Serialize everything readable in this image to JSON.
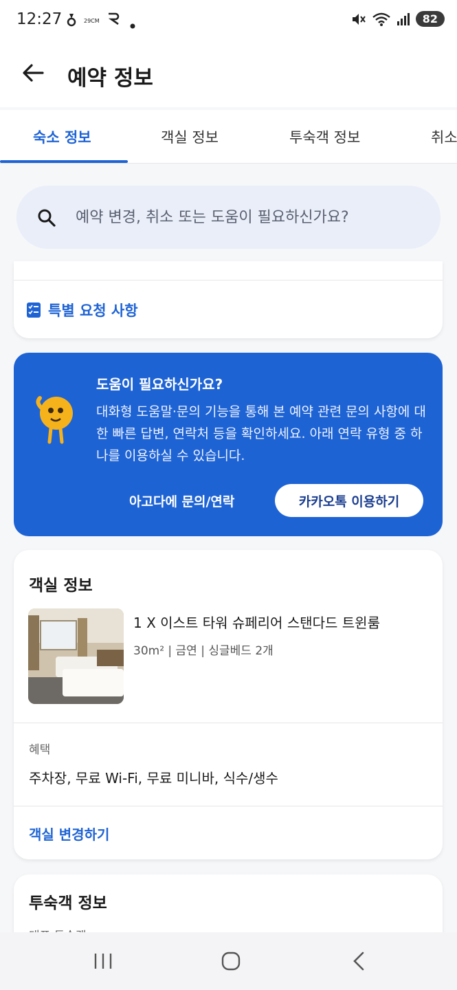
{
  "status_bar": {
    "time": "12:27",
    "icons": [
      "notification-icon",
      "29cm-icon",
      "r-app-icon",
      "dot-icon"
    ],
    "small_label": "29CM",
    "battery": "82"
  },
  "header": {
    "title": "예약 정보"
  },
  "tabs": [
    {
      "label": "숙소 정보",
      "active": true
    },
    {
      "label": "객실 정보",
      "active": false
    },
    {
      "label": "투숙객 정보",
      "active": false
    },
    {
      "label": "취소",
      "active": false
    }
  ],
  "search": {
    "placeholder": "예약 변경, 취소 또는 도움이 필요하신가요?"
  },
  "special_request": {
    "label": "특별 요청 사항"
  },
  "help_banner": {
    "title": "도움이 필요하신가요?",
    "body": "대화형 도움말·문의 기능을 통해 본 예약 관련 문의 사항에 대한 빠른 답변, 연락처 등을 확인하세요. 아래 연락 유형 중 하나를 이용하실 수 있습니다.",
    "contact_link": "아고다에 문의/연락",
    "kakao_button": "카카오톡 이용하기"
  },
  "room_info": {
    "title": "객실 정보",
    "room_name": "1 X 이스트 타워 슈페리어 스탠다드 트윈룸",
    "room_meta": "30m² | 금연 | 싱글베드 2개",
    "benefit_label": "혜택",
    "benefits": "주차장, 무료 Wi-Fi, 무료 미니바, 식수/생수",
    "change_link": "객실 변경하기"
  },
  "guest_info": {
    "title": "투숙객 정보",
    "sub_label": "대표 투숙객"
  },
  "colors": {
    "accent": "#1e63d4",
    "search_bg": "#e9eef9",
    "page_bg": "#f6f7f9"
  }
}
